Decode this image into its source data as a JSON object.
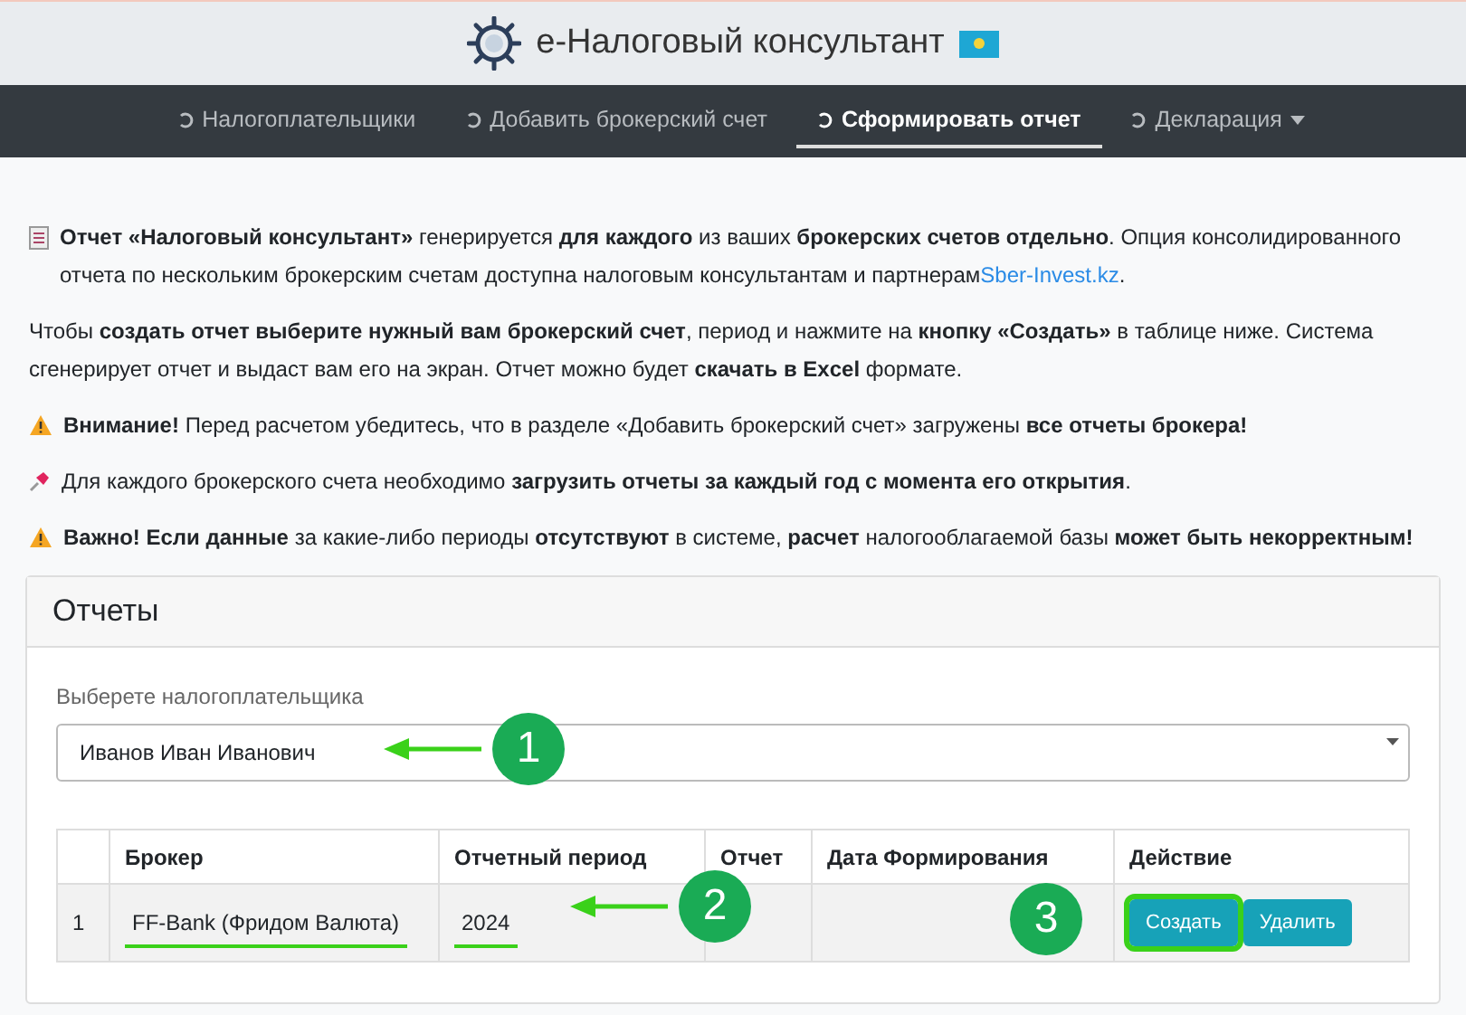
{
  "header": {
    "title": "e-Налоговый консультант"
  },
  "nav": [
    {
      "label": "Налогоплательщики",
      "selected": false,
      "dropdown": false
    },
    {
      "label": "Добавить брокерский счет",
      "selected": false,
      "dropdown": false
    },
    {
      "label": "Сформировать отчет",
      "selected": true,
      "dropdown": false
    },
    {
      "label": "Декларация",
      "selected": false,
      "dropdown": true
    }
  ],
  "notes": [
    {
      "kind": "doc",
      "text": "**Отчет «Налоговый консультант»** генерируется **для каждого** из ваших **брокерских счетов отдельно**. Опция консолидированного отчета по нескольким брокерским счетам доступна налоговым консультантам и партнерам",
      "link": "Sber-Invest.kz",
      "tail": "."
    },
    {
      "kind": "plain",
      "text": "Чтобы **создать отчет выберите нужный вам брокерский счет**, период и нажмите на **кнопку «Создать»** в таблице ниже. Система сгенерирует отчет и выдаст вам его на экран. Отчет можно будет **скачать в Excel** формате."
    },
    {
      "kind": "warning",
      "text": "**Внимание!** Перед расчетом убедитесь, что в разделе «Добавить брокерский счет» загружены **все отчеты брокера!**"
    },
    {
      "kind": "pin",
      "text": "Для каждого брокерского счета необходимо **загрузить отчеты за каждый год с момента его открытия**."
    },
    {
      "kind": "warning",
      "text": "**Важно! Если данные** за какие-либо периоды **отсутствуют** в системе, **расчет** налогооблагаемой базы **может быть некорректным!**"
    }
  ],
  "card": {
    "title": "Отчеты",
    "select_label": "Выберете налогоплательщика",
    "select_value": "Иванов Иван Иванович",
    "columns": [
      "Брокер",
      "Отчетный период",
      "Отчет",
      "Дата Формирования",
      "Действие"
    ],
    "rows": [
      {
        "index": "1",
        "broker": "FF-Bank (Фридом Валюта)",
        "broker_underlined": true,
        "period": "2024",
        "period_underlined": true,
        "actions": [
          {
            "label": "Создать",
            "highlighted": true
          },
          {
            "label": "Удалить",
            "highlighted": false
          }
        ]
      }
    ]
  },
  "markers": [
    {
      "number": "1",
      "arrow": true
    },
    {
      "number": "2",
      "arrow": true
    },
    {
      "number": "3",
      "arrow": false
    }
  ]
}
